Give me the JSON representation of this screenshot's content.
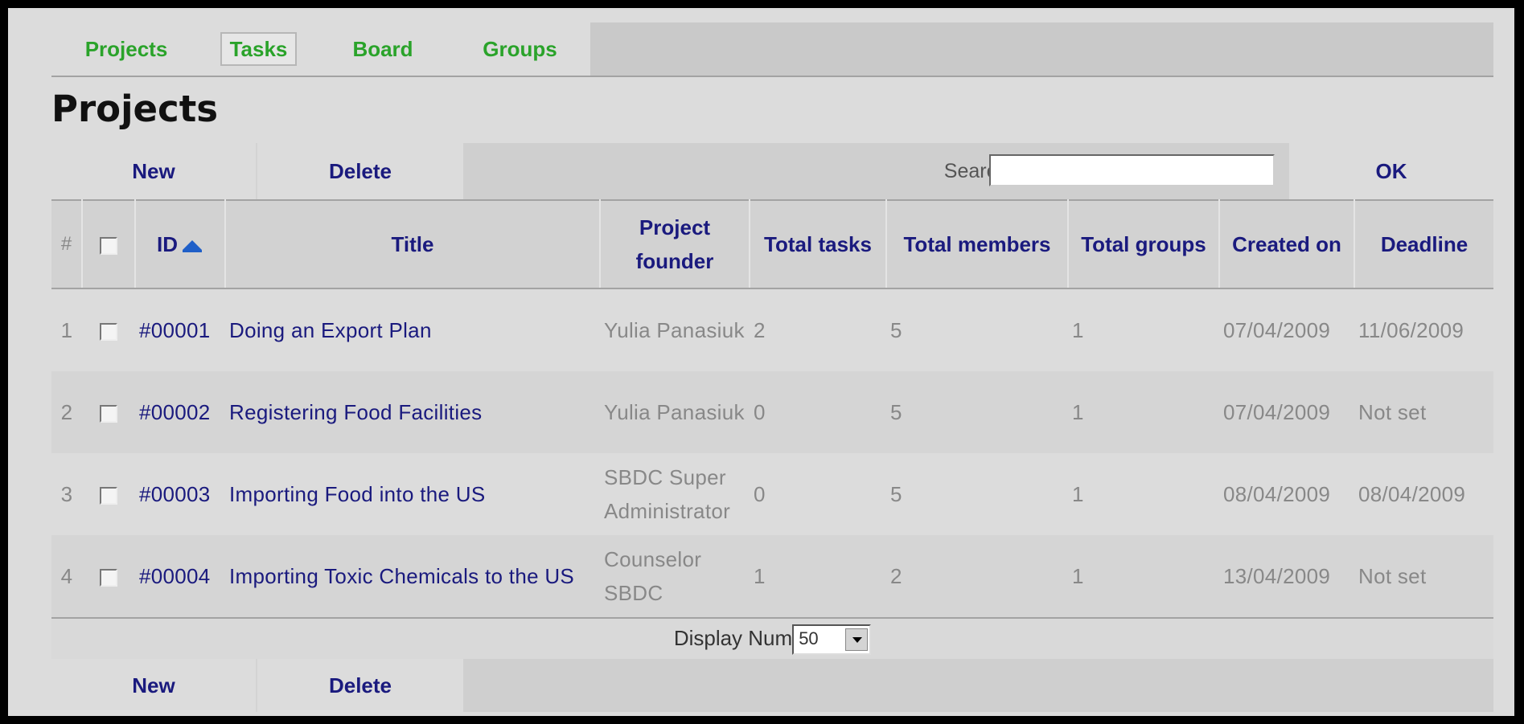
{
  "nav": {
    "tabs": [
      {
        "label": "Projects"
      },
      {
        "label": "Tasks",
        "active": true
      },
      {
        "label": "Board"
      },
      {
        "label": "Groups"
      }
    ]
  },
  "page": {
    "title": "Projects"
  },
  "toolbar": {
    "new_label": "New",
    "delete_label": "Delete",
    "search_label": "Search",
    "search_value": "",
    "ok_label": "OK"
  },
  "table": {
    "headers": {
      "hash": "#",
      "id": "ID",
      "title": "Title",
      "founder": "Project founder",
      "total_tasks": "Total tasks",
      "total_members": "Total members",
      "total_groups": "Total groups",
      "created_on": "Created on",
      "deadline": "Deadline"
    },
    "rows": [
      {
        "n": "1",
        "id": "#00001",
        "title": "Doing an Export Plan",
        "founder": "Yulia Panasiuk",
        "tasks": "2",
        "members": "5",
        "groups": "1",
        "created": "07/04/2009",
        "deadline": "11/06/2009"
      },
      {
        "n": "2",
        "id": "#00002",
        "title": "Registering Food Facilities",
        "founder": "Yulia Panasiuk",
        "tasks": "0",
        "members": "5",
        "groups": "1",
        "created": "07/04/2009",
        "deadline": "Not set"
      },
      {
        "n": "3",
        "id": "#00003",
        "title": "Importing Food into the US",
        "founder": "SBDC Super Administrator",
        "tasks": "0",
        "members": "5",
        "groups": "1",
        "created": "08/04/2009",
        "deadline": "08/04/2009"
      },
      {
        "n": "4",
        "id": "#00004",
        "title": "Importing Toxic Chemicals to the US",
        "founder": "Counselor SBDC",
        "tasks": "1",
        "members": "2",
        "groups": "1",
        "created": "13/04/2009",
        "deadline": "Not set"
      }
    ]
  },
  "pager": {
    "label": "Display Num",
    "value": "50"
  },
  "colors": {
    "nav_link": "#2aa32a",
    "action_link": "#1a1a7e",
    "muted_text": "#888888"
  },
  "icons": {
    "sort": "sort-ascending-icon",
    "dropdown": "chevron-down-icon"
  }
}
